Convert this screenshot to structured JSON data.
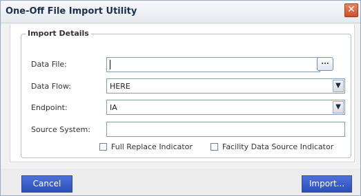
{
  "dialog": {
    "title": "One-Off File Import Utility",
    "close_glyph": "✕"
  },
  "import_details": {
    "legend": "Import Details",
    "data_file": {
      "label": "Data File:",
      "value": "",
      "browse_label": "..."
    },
    "data_flow": {
      "label": "Data Flow:",
      "selected": "HERE"
    },
    "endpoint": {
      "label": "Endpoint:",
      "selected": "IA"
    },
    "source_system": {
      "label": "Source System:",
      "value": ""
    },
    "full_replace": {
      "label": "Full Replace Indicator",
      "checked": false
    },
    "facility_source": {
      "label": "Facility Data Source Indicator",
      "checked": false
    }
  },
  "footer": {
    "cancel_label": "Cancel",
    "import_label": "Import..."
  },
  "icons": {
    "dropdown": "chevron-down-icon",
    "close": "close-icon"
  },
  "colors": {
    "button_blue": "#3a5fcd",
    "close_red": "#d9623e",
    "title_text": "#1c2f4d"
  }
}
